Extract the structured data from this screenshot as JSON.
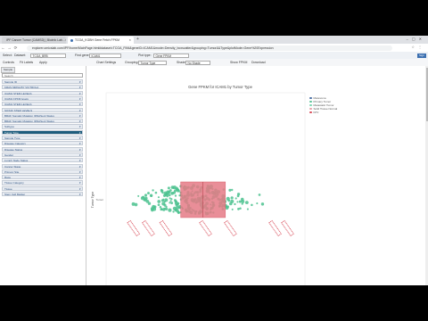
{
  "browser": {
    "tabs": [
      {
        "title": "IPF Cancer Tumor (CAMSD) | Bioinfo Lab...",
        "color": "#e8542f"
      },
      {
        "title": "TCGA_KGBH Gene Fetch FPKM",
        "color": "#3b6fb0"
      }
    ],
    "url": "explorer.omicslab.com/IPF/home/MainPage.html#dataset=TCGA_PAN&geneID=ICAM1&mode=Density_boxscatter&grouping=Tumor&&Type&plotMode=Gene%20Expression"
  },
  "app_toolbar": {
    "select_label": "Select:",
    "dataset_label": "Dataset:",
    "dataset_value": "TCGA_BRB",
    "find_gene_label": "Find gene:",
    "find_gene_value": "ICAM1",
    "plot_type_label": "Plot type:",
    "plot_type_value": "Gene FPKM",
    "signout": "Sign out"
  },
  "plot_toolbar": {
    "controls_label": "Controls",
    "subtitles_label": "Fit Labels",
    "apply_label": "Apply",
    "chart_settings_label": "Chart Settings",
    "grouping_label": "Grouping:",
    "grouping_value": "Tumor Type",
    "shade_label": "Shade:",
    "shade_value": "No Shade",
    "show_fpkm_label": "Show FPKM",
    "download_label": "Download"
  },
  "sidebar": {
    "tab_label": "Sample",
    "search_placeholder": "Search",
    "items": [
      {
        "label": "Sample ID",
        "active": false
      },
      {
        "label": "KRAS MRNA BY VICTROLA",
        "active": false
      },
      {
        "label": "ICAM1 STEM LEVELS",
        "active": false
      },
      {
        "label": "ICAM1 FPKM levels",
        "active": false
      },
      {
        "label": "ICAM1 STEM LEVELS",
        "active": false
      },
      {
        "label": "SOX2F STEM LEVELS",
        "active": false
      },
      {
        "label": "BRAF Somatic Mutation (DNASeq) Status",
        "active": false
      },
      {
        "label": "BRAF Somatic Mutation (DNASeq) Status",
        "active": false
      },
      {
        "label": "Subtype",
        "active": false
      },
      {
        "label": "Tumor Type",
        "active": true
      },
      {
        "label": "Sample Type",
        "active": false
      },
      {
        "label": "Disease Category",
        "active": false
      },
      {
        "label": "Disease Status",
        "active": false
      },
      {
        "label": "Gender",
        "active": false
      },
      {
        "label": "Lymph Node Status",
        "active": false
      },
      {
        "label": "Cancer Stage",
        "active": false
      },
      {
        "label": "Primary Site",
        "active": false
      },
      {
        "label": "Race",
        "active": false
      },
      {
        "label": "Tissue Category",
        "active": false
      },
      {
        "label": "Tissue",
        "active": false
      },
      {
        "label": "Stem Cell Marker",
        "active": false
      }
    ]
  },
  "plot": {
    "title": "Gene FPKM for ICAM1 by Tumor Type",
    "xlabel": "Gene Expression (ICAM1) FPKM (+0.1)",
    "ylabel": "Tumor Type",
    "y_tick": "Tumor",
    "legend": [
      {
        "label": "Melanoma",
        "color": "#4a6fa5"
      },
      {
        "label": "Primary Tumor",
        "color": "#5fc39a"
      },
      {
        "label": "Metastatic Tumor",
        "color": "#7fd6b3"
      },
      {
        "label": "Solid Tissue Normal",
        "color": "#e8a0a8"
      },
      {
        "label": "FPV",
        "color": "#d94f5c"
      }
    ],
    "accent_colors": {
      "box": "#e57a86",
      "points": "#4cc28f",
      "labels": "#d94f5c"
    }
  },
  "chart_data": {
    "type": "scatter",
    "title": "Gene FPKM for ICAM1 by Tumor Type",
    "xlabel": "Gene Expression (ICAM1) FPKM (+0.1)",
    "ylabel": "Tumor Type",
    "categories": [
      "Tumor"
    ],
    "xlim": [
      0,
      8
    ],
    "xticks": [
      "0",
      "1",
      "2",
      "3",
      "4",
      "5",
      "6",
      "7",
      "8"
    ],
    "box": {
      "q1": 3.0,
      "median": 3.9,
      "q3": 4.8
    },
    "series": [
      {
        "name": "Primary Tumor",
        "x_range": [
          0.6,
          6.8
        ]
      }
    ]
  }
}
